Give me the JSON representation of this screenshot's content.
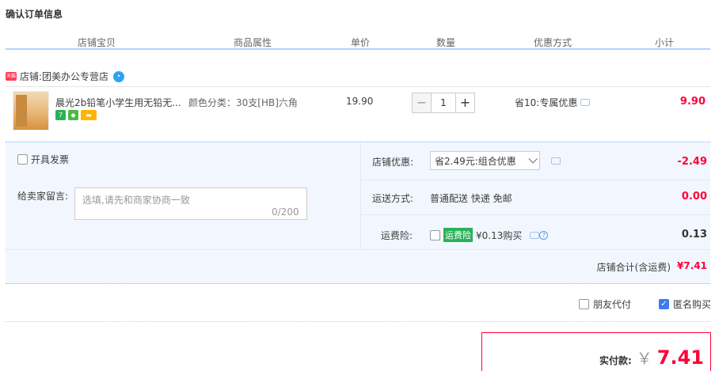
{
  "page": {
    "title": "确认订单信息"
  },
  "columns": [
    "店铺宝贝",
    "商品属性",
    "单价",
    "数量",
    "优惠方式",
    "小计"
  ],
  "shop": {
    "prefix": "店铺: ",
    "name": "团美办公专营店"
  },
  "item": {
    "name": "晨光2b铅笔小学生用无铅无...",
    "sku": "颜色分类：30支[HB]六角",
    "price": "19.90",
    "quantity": "1",
    "decrement_label": "−",
    "increment_label": "+",
    "promo": "省10:专属优惠",
    "subtotal": "9.90",
    "badge_seven": "7"
  },
  "order_options": {
    "invoice_label": "开具发票",
    "message_label": "给卖家留言:",
    "message_placeholder": "选填,请先和商家协商一致",
    "message_count": "0/200",
    "shop_discount_label": "店铺优惠:",
    "shop_discount_select": "省2.49元:组合优惠",
    "shop_discount_amount": "-2.49",
    "shipping_label": "运送方式:",
    "shipping_value": "普通配送 快递 免邮",
    "shipping_amount": "0.00",
    "insurance_label": "运费险:",
    "insurance_tag": "运费险",
    "insurance_value": "¥0.13购买",
    "insurance_amount": "0.13",
    "shop_total_label": "店铺合计(含运费)",
    "shop_total_value": "¥7.41"
  },
  "extras": {
    "friend_pay_label": "朋友代付",
    "friend_pay_checked": false,
    "anonymous_label": "匿名购买",
    "anonymous_checked": true
  },
  "payment": {
    "label": "实付款:",
    "currency": "￥",
    "value": "7.41"
  },
  "colors": {
    "price_red": "#ff0036",
    "header_line": "#b2d1ff",
    "panel_bg": "#f2f7ff"
  }
}
